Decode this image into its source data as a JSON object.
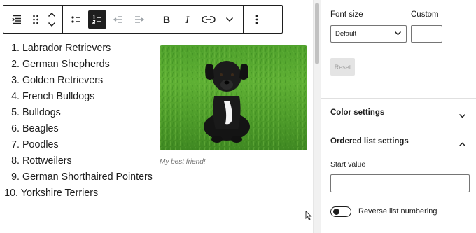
{
  "toolbar": {
    "buttons": [
      {
        "name": "list-block-icon"
      },
      {
        "name": "drag-handle-icon"
      },
      {
        "name": "move-up-icon"
      },
      {
        "name": "move-down-icon"
      },
      {
        "name": "unordered-list-icon"
      },
      {
        "name": "ordered-list-icon",
        "active": true
      },
      {
        "name": "outdent-icon",
        "disabled": true
      },
      {
        "name": "indent-icon",
        "disabled": true
      },
      {
        "name": "bold-icon"
      },
      {
        "name": "italic-icon"
      },
      {
        "name": "link-icon"
      },
      {
        "name": "more-rich-text-icon"
      },
      {
        "name": "options-kebab-icon"
      }
    ]
  },
  "list": {
    "items": [
      {
        "num": "1.",
        "text": "Labrador Retrievers"
      },
      {
        "num": "2.",
        "text": "German Shepherds"
      },
      {
        "num": "3.",
        "text": "Golden Retrievers"
      },
      {
        "num": "4.",
        "text": "French Bulldogs"
      },
      {
        "num": "5.",
        "text": "Bulldogs"
      },
      {
        "num": "6.",
        "text": "Beagles"
      },
      {
        "num": "7.",
        "text": "Poodles"
      },
      {
        "num": "8.",
        "text": "Rottweilers"
      },
      {
        "num": "9.",
        "text": "German Shorthaired Pointers"
      },
      {
        "num": "10.",
        "text": "Yorkshire Terriers"
      }
    ]
  },
  "figure": {
    "caption": "My best friend!"
  },
  "sidebar": {
    "typography": {
      "font_size_label": "Font size",
      "custom_label": "Custom",
      "select_value": "Default",
      "custom_value": "",
      "reset_label": "Reset"
    },
    "color_settings": {
      "title": "Color settings",
      "expanded": false
    },
    "ordered_list_settings": {
      "title": "Ordered list settings",
      "expanded": true,
      "start_value_label": "Start value",
      "start_value": "",
      "reverse_label": "Reverse list numbering",
      "reverse_enabled": false
    }
  },
  "colors": {
    "text": "#1e1e1e",
    "muted": "#757575",
    "border": "#e0e0e0",
    "grass": "#4fa12c"
  }
}
